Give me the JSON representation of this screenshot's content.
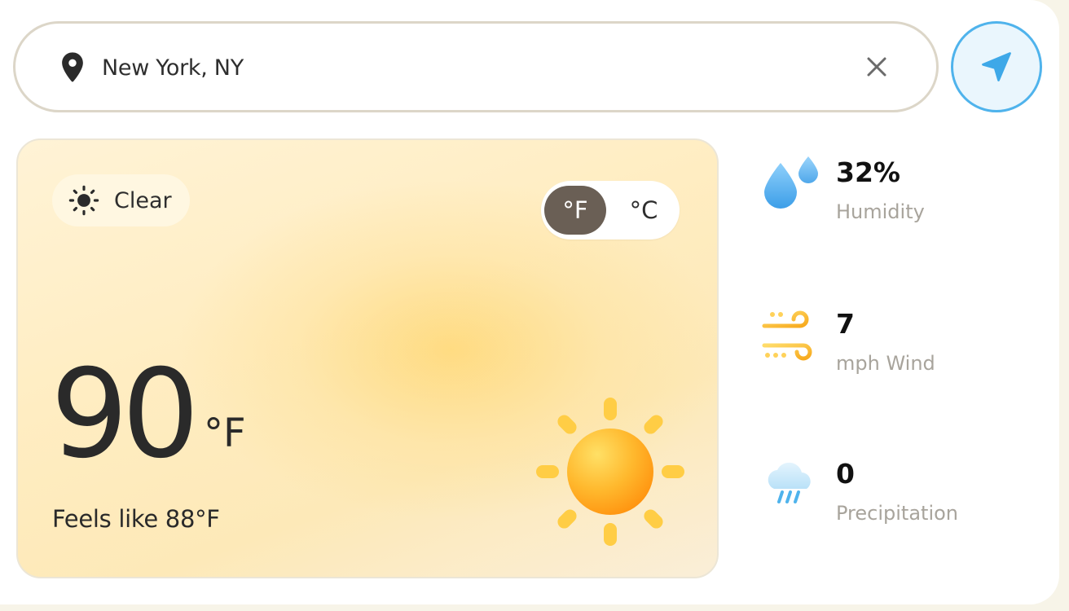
{
  "search": {
    "location": "New York, NY",
    "icons": {
      "pin": "map-pin-icon",
      "clear": "close-icon",
      "locate": "navigation-arrow-icon"
    }
  },
  "current": {
    "condition": "Clear",
    "condition_icon": "sun-icon",
    "temperature": "90",
    "temperature_unit": "°F",
    "feels_like": "Feels like 88°F",
    "units": {
      "fahrenheit": "°F",
      "celsius": "°C",
      "selected": "fahrenheit"
    }
  },
  "stats": [
    {
      "value": "32%",
      "label": "Humidity",
      "icon": "humidity-drops-icon"
    },
    {
      "value": "7",
      "label": "mph Wind",
      "icon": "wind-icon"
    },
    {
      "value": "0",
      "label": "Precipitation",
      "icon": "rain-cloud-icon"
    }
  ],
  "colors": {
    "accent_blue": "#4fb3ec",
    "toggle_selected": "#6a5f55",
    "sun": "#ffa820"
  }
}
